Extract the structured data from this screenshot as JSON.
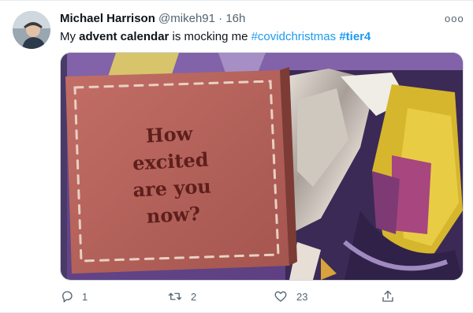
{
  "tweet": {
    "author_name": "Michael Harrison",
    "handle": "@mikeh91",
    "separator": "·",
    "time": "16h",
    "more_label": "ooo",
    "text": {
      "part1": "My ",
      "bold": "advent calendar",
      "part2": " is mocking me ",
      "hashtag1": "#covidchristmas",
      "hashtag2": "#tier4"
    },
    "image": {
      "card_lines": [
        "How",
        "excited",
        "are you",
        "now?"
      ]
    },
    "actions": {
      "reply_count": "1",
      "retweet_count": "2",
      "like_count": "23"
    }
  },
  "colors": {
    "link": "#1d9bf0",
    "secondary_text": "#536471",
    "card": "#b5645c"
  },
  "icons": [
    "avatar-photo",
    "more-icon",
    "reply-icon",
    "retweet-icon",
    "like-icon",
    "share-icon"
  ]
}
